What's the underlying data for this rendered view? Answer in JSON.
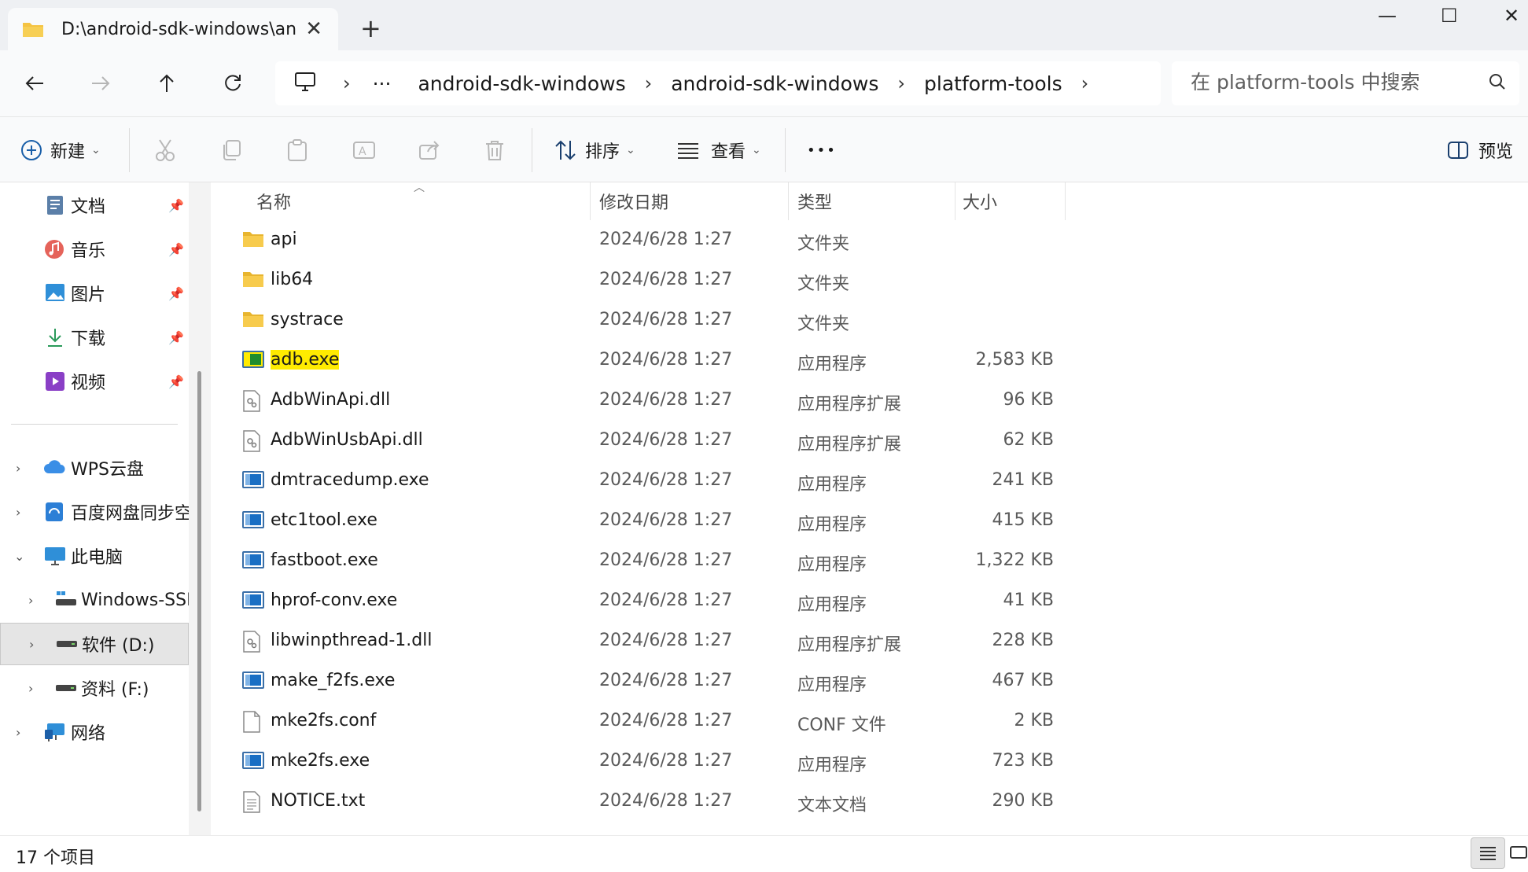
{
  "tab": {
    "title": "D:\\android-sdk-windows\\andr",
    "close_glyph": "✕",
    "new_tab_glyph": "+"
  },
  "window_controls": {
    "minimize": "—",
    "maximize": "☐",
    "close": "✕"
  },
  "address_bar": {
    "overflow": "···",
    "segments": [
      "android-sdk-windows",
      "android-sdk-windows",
      "platform-tools"
    ]
  },
  "search": {
    "placeholder": "在 platform-tools 中搜索"
  },
  "toolbar": {
    "new_label": "新建",
    "sort_label": "排序",
    "view_label": "查看",
    "more_glyph": "•••",
    "preview_label": "预览"
  },
  "sidebar": {
    "quick_access": [
      {
        "label": "文档",
        "icon": "documents-icon"
      },
      {
        "label": "音乐",
        "icon": "music-icon"
      },
      {
        "label": "图片",
        "icon": "pictures-icon"
      },
      {
        "label": "下载",
        "icon": "downloads-icon"
      },
      {
        "label": "视频",
        "icon": "videos-icon"
      }
    ],
    "tree": [
      {
        "label": "WPS云盘",
        "icon": "cloud-icon"
      },
      {
        "label": "百度网盘同步空间",
        "icon": "baidu-netdisk-icon"
      },
      {
        "label": "此电脑",
        "icon": "this-pc-icon"
      },
      {
        "label": "Windows-SSD (C:)",
        "icon": "drive-c-icon"
      },
      {
        "label": "软件 (D:)",
        "icon": "drive-d-icon"
      },
      {
        "label": "资料 (F:)",
        "icon": "drive-f-icon"
      },
      {
        "label": "网络",
        "icon": "network-icon"
      }
    ]
  },
  "columns": {
    "name": "名称",
    "modified": "修改日期",
    "type": "类型",
    "size": "大小"
  },
  "files": [
    {
      "name": "api",
      "modified": "2024/6/28 1:27",
      "type": "文件夹",
      "size": "",
      "icon": "folder-icon"
    },
    {
      "name": "lib64",
      "modified": "2024/6/28 1:27",
      "type": "文件夹",
      "size": "",
      "icon": "folder-icon"
    },
    {
      "name": "systrace",
      "modified": "2024/6/28 1:27",
      "type": "文件夹",
      "size": "",
      "icon": "folder-icon"
    },
    {
      "name": "adb.exe",
      "modified": "2024/6/28 1:27",
      "type": "应用程序",
      "size": "2,583 KB",
      "icon": "exe-icon",
      "highlighted": true
    },
    {
      "name": "AdbWinApi.dll",
      "modified": "2024/6/28 1:27",
      "type": "应用程序扩展",
      "size": "96 KB",
      "icon": "dll-icon"
    },
    {
      "name": "AdbWinUsbApi.dll",
      "modified": "2024/6/28 1:27",
      "type": "应用程序扩展",
      "size": "62 KB",
      "icon": "dll-icon"
    },
    {
      "name": "dmtracedump.exe",
      "modified": "2024/6/28 1:27",
      "type": "应用程序",
      "size": "241 KB",
      "icon": "exe-icon"
    },
    {
      "name": "etc1tool.exe",
      "modified": "2024/6/28 1:27",
      "type": "应用程序",
      "size": "415 KB",
      "icon": "exe-icon"
    },
    {
      "name": "fastboot.exe",
      "modified": "2024/6/28 1:27",
      "type": "应用程序",
      "size": "1,322 KB",
      "icon": "exe-icon"
    },
    {
      "name": "hprof-conv.exe",
      "modified": "2024/6/28 1:27",
      "type": "应用程序",
      "size": "41 KB",
      "icon": "exe-icon"
    },
    {
      "name": "libwinpthread-1.dll",
      "modified": "2024/6/28 1:27",
      "type": "应用程序扩展",
      "size": "228 KB",
      "icon": "dll-icon"
    },
    {
      "name": "make_f2fs.exe",
      "modified": "2024/6/28 1:27",
      "type": "应用程序",
      "size": "467 KB",
      "icon": "exe-icon"
    },
    {
      "name": "mke2fs.conf",
      "modified": "2024/6/28 1:27",
      "type": "CONF 文件",
      "size": "2 KB",
      "icon": "file-icon"
    },
    {
      "name": "mke2fs.exe",
      "modified": "2024/6/28 1:27",
      "type": "应用程序",
      "size": "723 KB",
      "icon": "exe-icon"
    },
    {
      "name": "NOTICE.txt",
      "modified": "2024/6/28 1:27",
      "type": "文本文档",
      "size": "290 KB",
      "icon": "text-file-icon"
    }
  ],
  "status": {
    "item_count": "17 个项目"
  },
  "colors": {
    "highlight": "#ffeb00",
    "folder": "#f5c342",
    "exe_blue": "#1a6fc4",
    "selected_bg": "#e5e5e5"
  }
}
